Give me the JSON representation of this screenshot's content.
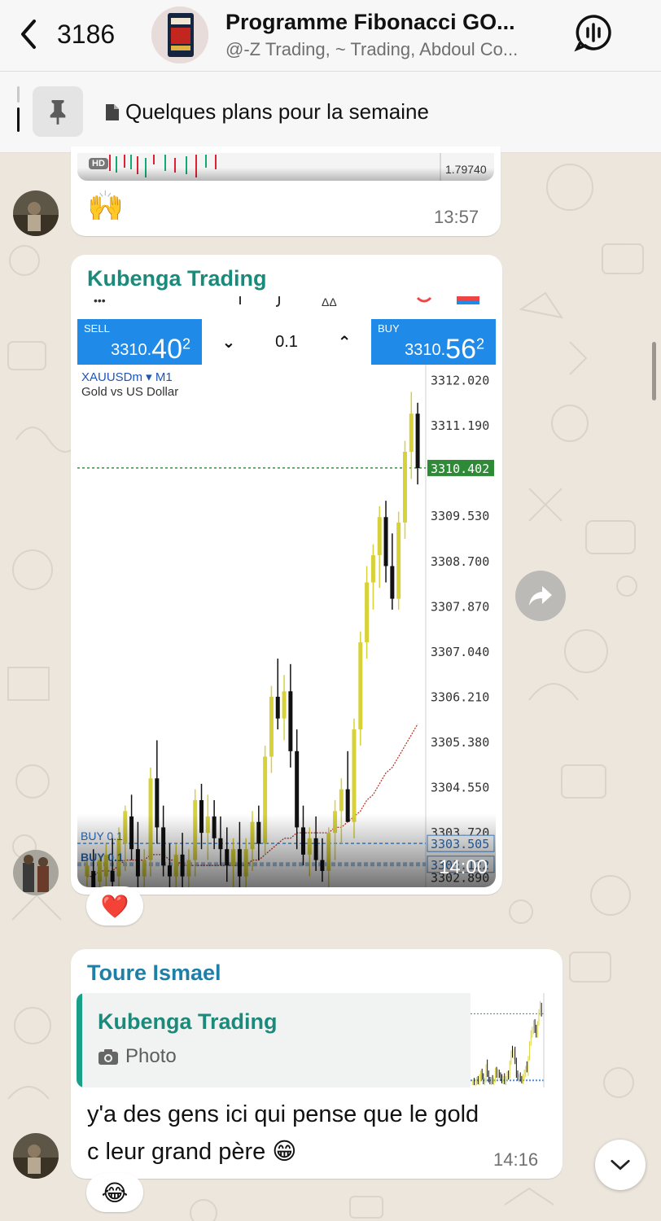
{
  "header": {
    "back_count": "3186",
    "title": "Programme Fibonacci GO...",
    "subtitle": "@-Z Trading, ~ Trading, Abdoul Co..."
  },
  "pinned": {
    "text": "Quelques plans pour la semaine"
  },
  "messages": {
    "m1": {
      "emoji": "🙌",
      "time": "13:57",
      "prev_chart_price": "1.79740",
      "prev_chart_badge": "HD"
    },
    "m2": {
      "sender": "Kubenga Trading",
      "time": "14:00",
      "reaction": "❤️",
      "chart": {
        "sell_label": "SELL",
        "sell_price_main": "3310.",
        "sell_price_big": "40",
        "sell_price_sup": "2",
        "buy_label": "BUY",
        "buy_price_main": "3310.",
        "buy_price_big": "56",
        "buy_price_sup": "2",
        "lot": "0.1",
        "symbol": "XAUUSDm ▾ M1",
        "symbol_desc": "Gold vs US Dollar",
        "order_label_1": "BUY 0.1",
        "order_label_2": "BUY 0.1"
      }
    },
    "m3": {
      "sender": "Toure Ismael",
      "quote_sender": "Kubenga Trading",
      "quote_type": "Photo",
      "text_line1": "y'a des gens ici qui pense que le gold",
      "text_line2": "c leur grand père 😁",
      "time": "14:16",
      "reaction": "😂"
    }
  },
  "chart_data": {
    "type": "candlestick",
    "title": "XAUUSDm ▾ M1",
    "subtitle": "Gold vs US Dollar",
    "y_tick_labels": [
      "3312.020",
      "3311.190",
      "3310.402",
      "3309.530",
      "3308.700",
      "3307.870",
      "3307.040",
      "3306.210",
      "3305.380",
      "3304.550",
      "3303.720",
      "3303.505",
      "3303.122",
      "3302.890"
    ],
    "ylim": [
      3302.7,
      3312.3
    ],
    "current_price": 3310.402,
    "order_levels": [
      3303.505,
      3303.122
    ],
    "candles": [
      {
        "o": 3302.9,
        "h": 3303.2,
        "l": 3302.6,
        "c": 3303.1
      },
      {
        "o": 3303.0,
        "h": 3303.4,
        "l": 3302.6,
        "c": 3302.7
      },
      {
        "o": 3302.8,
        "h": 3303.3,
        "l": 3302.5,
        "c": 3303.2
      },
      {
        "o": 3302.9,
        "h": 3303.5,
        "l": 3302.6,
        "c": 3303.3
      },
      {
        "o": 3303.0,
        "h": 3303.6,
        "l": 3302.7,
        "c": 3302.8
      },
      {
        "o": 3302.9,
        "h": 3303.8,
        "l": 3302.6,
        "c": 3303.6
      },
      {
        "o": 3303.5,
        "h": 3304.2,
        "l": 3303.0,
        "c": 3304.1
      },
      {
        "o": 3304.0,
        "h": 3304.4,
        "l": 3303.2,
        "c": 3303.4
      },
      {
        "o": 3303.4,
        "h": 3303.9,
        "l": 3302.7,
        "c": 3302.9
      },
      {
        "o": 3302.9,
        "h": 3303.4,
        "l": 3302.6,
        "c": 3303.2
      },
      {
        "o": 3303.2,
        "h": 3304.9,
        "l": 3302.9,
        "c": 3304.7
      },
      {
        "o": 3304.7,
        "h": 3305.4,
        "l": 3303.5,
        "c": 3303.8
      },
      {
        "o": 3303.8,
        "h": 3304.2,
        "l": 3302.9,
        "c": 3303.1
      },
      {
        "o": 3303.1,
        "h": 3303.5,
        "l": 3302.7,
        "c": 3302.9
      },
      {
        "o": 3302.9,
        "h": 3303.5,
        "l": 3302.6,
        "c": 3303.3
      },
      {
        "o": 3303.3,
        "h": 3303.7,
        "l": 3302.7,
        "c": 3302.9
      },
      {
        "o": 3302.9,
        "h": 3303.4,
        "l": 3302.6,
        "c": 3303.2
      },
      {
        "o": 3303.2,
        "h": 3304.5,
        "l": 3302.9,
        "c": 3304.3
      },
      {
        "o": 3304.3,
        "h": 3304.6,
        "l": 3303.4,
        "c": 3303.7
      },
      {
        "o": 3303.7,
        "h": 3304.4,
        "l": 3303.2,
        "c": 3304.0
      },
      {
        "o": 3304.0,
        "h": 3304.3,
        "l": 3303.4,
        "c": 3303.6
      },
      {
        "o": 3303.6,
        "h": 3304.0,
        "l": 3303.1,
        "c": 3303.4
      },
      {
        "o": 3303.4,
        "h": 3303.8,
        "l": 3302.8,
        "c": 3303.1
      },
      {
        "o": 3303.1,
        "h": 3303.6,
        "l": 3302.7,
        "c": 3303.4
      },
      {
        "o": 3303.4,
        "h": 3303.9,
        "l": 3302.7,
        "c": 3302.9
      },
      {
        "o": 3302.9,
        "h": 3303.6,
        "l": 3302.6,
        "c": 3303.4
      },
      {
        "o": 3303.4,
        "h": 3304.1,
        "l": 3303.0,
        "c": 3303.9
      },
      {
        "o": 3303.9,
        "h": 3304.2,
        "l": 3303.2,
        "c": 3303.5
      },
      {
        "o": 3303.5,
        "h": 3305.3,
        "l": 3303.3,
        "c": 3305.1
      },
      {
        "o": 3305.1,
        "h": 3306.4,
        "l": 3304.8,
        "c": 3306.2
      },
      {
        "o": 3306.2,
        "h": 3306.9,
        "l": 3305.6,
        "c": 3305.8
      },
      {
        "o": 3305.8,
        "h": 3306.6,
        "l": 3305.4,
        "c": 3306.3
      },
      {
        "o": 3306.3,
        "h": 3306.8,
        "l": 3304.9,
        "c": 3305.2
      },
      {
        "o": 3305.2,
        "h": 3305.6,
        "l": 3303.4,
        "c": 3303.8
      },
      {
        "o": 3303.8,
        "h": 3304.2,
        "l": 3303.1,
        "c": 3303.3
      },
      {
        "o": 3303.3,
        "h": 3303.8,
        "l": 3302.9,
        "c": 3303.6
      },
      {
        "o": 3303.6,
        "h": 3304.0,
        "l": 3303.0,
        "c": 3303.2
      },
      {
        "o": 3303.2,
        "h": 3303.6,
        "l": 3302.8,
        "c": 3303.0
      },
      {
        "o": 3303.0,
        "h": 3303.8,
        "l": 3302.7,
        "c": 3303.7
      },
      {
        "o": 3303.7,
        "h": 3304.3,
        "l": 3303.2,
        "c": 3304.1
      },
      {
        "o": 3304.1,
        "h": 3304.7,
        "l": 3303.5,
        "c": 3304.5
      },
      {
        "o": 3304.5,
        "h": 3305.2,
        "l": 3304.0,
        "c": 3303.9
      },
      {
        "o": 3303.9,
        "h": 3305.8,
        "l": 3303.6,
        "c": 3305.6
      },
      {
        "o": 3305.6,
        "h": 3307.4,
        "l": 3305.3,
        "c": 3307.2
      },
      {
        "o": 3307.2,
        "h": 3308.6,
        "l": 3306.9,
        "c": 3308.3
      },
      {
        "o": 3308.3,
        "h": 3309.0,
        "l": 3307.8,
        "c": 3308.8
      },
      {
        "o": 3308.8,
        "h": 3309.7,
        "l": 3308.2,
        "c": 3309.5
      },
      {
        "o": 3309.5,
        "h": 3309.8,
        "l": 3308.3,
        "c": 3308.6
      },
      {
        "o": 3308.6,
        "h": 3309.2,
        "l": 3307.8,
        "c": 3308.0
      },
      {
        "o": 3308.0,
        "h": 3309.6,
        "l": 3307.8,
        "c": 3309.4
      },
      {
        "o": 3309.4,
        "h": 3310.9,
        "l": 3309.1,
        "c": 3310.7
      },
      {
        "o": 3310.7,
        "h": 3311.8,
        "l": 3310.2,
        "c": 3311.4
      },
      {
        "o": 3311.4,
        "h": 3311.6,
        "l": 3310.1,
        "c": 3310.4
      }
    ],
    "ma": [
      3302.9,
      3302.9,
      3303.0,
      3303.0,
      3303.0,
      3303.1,
      3303.2,
      3303.2,
      3303.2,
      3303.2,
      3303.3,
      3303.3,
      3303.3,
      3303.2,
      3303.2,
      3303.1,
      3303.1,
      3303.1,
      3303.1,
      3303.1,
      3303.1,
      3303.1,
      3303.1,
      3303.1,
      3303.1,
      3303.1,
      3303.2,
      3303.2,
      3303.3,
      3303.4,
      3303.5,
      3303.6,
      3303.6,
      3303.7,
      3303.7,
      3303.7,
      3303.7,
      3303.7,
      3303.7,
      3303.8,
      3303.8,
      3303.9,
      3304.0,
      3304.1,
      3304.3,
      3304.4,
      3304.6,
      3304.8,
      3304.9,
      3305.1,
      3305.3,
      3305.5,
      3305.7
    ]
  },
  "colors": {
    "accent_teal": "#1a8a7a",
    "sender_blue": "#1e7fa8",
    "mt_blue": "#1f8ae7",
    "candle_bull": "#d8d23a",
    "candle_bear": "#111111"
  }
}
